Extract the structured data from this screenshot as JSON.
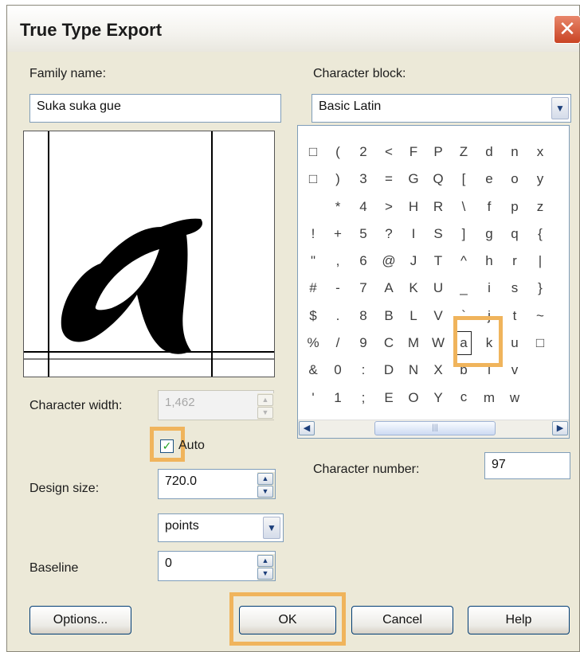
{
  "dialog": {
    "title": "True Type Export",
    "close_glyph": "✕"
  },
  "family": {
    "label": "Family name:",
    "value": "Suka suka gue"
  },
  "block": {
    "label": "Character block:",
    "value": "Basic Latin"
  },
  "preview": {
    "glyph": "a"
  },
  "grid": {
    "columns": [
      [
        "□",
        "□",
        "",
        "!",
        "\"",
        "#",
        "$",
        "%",
        "&",
        "'"
      ],
      [
        "(",
        ")",
        "*",
        "+",
        ",",
        "-",
        ".",
        "/",
        "0",
        "1"
      ],
      [
        "2",
        "3",
        "4",
        "5",
        "6",
        "7",
        "8",
        "9",
        ":",
        ";"
      ],
      [
        "<",
        "=",
        ">",
        "?",
        "@",
        "A",
        "B",
        "C",
        "D",
        "E"
      ],
      [
        "F",
        "G",
        "H",
        "I",
        "J",
        "K",
        "L",
        "M",
        "N",
        "O"
      ],
      [
        "P",
        "Q",
        "R",
        "S",
        "T",
        "U",
        "V",
        "W",
        "X",
        "Y"
      ],
      [
        "Z",
        "[",
        "\\",
        "]",
        "^",
        "_",
        "`",
        "a",
        "b",
        "c"
      ],
      [
        "d",
        "e",
        "f",
        "g",
        "h",
        "i",
        "j",
        "k",
        "l",
        "m"
      ],
      [
        "n",
        "o",
        "p",
        "q",
        "r",
        "s",
        "t",
        "u",
        "v",
        "w"
      ],
      [
        "x",
        "y",
        "z",
        "{",
        "|",
        "}",
        "~",
        "□",
        "",
        ""
      ]
    ],
    "scroll_grip": "|||"
  },
  "char_width": {
    "label": "Character width:",
    "value": "1,462"
  },
  "auto": {
    "label": "Auto",
    "checked": true
  },
  "char_number": {
    "label": "Character number:",
    "value": "97"
  },
  "design_size": {
    "label": "Design size:",
    "value": "720.0",
    "unit": "points"
  },
  "baseline": {
    "label": "Baseline",
    "value": "0"
  },
  "buttons": {
    "options": "Options...",
    "ok": "OK",
    "cancel": "Cancel",
    "help": "Help"
  },
  "colors": {
    "highlight": "#f0b45c",
    "dialog_bg": "#ece9d8",
    "title_close": "#c94424"
  }
}
